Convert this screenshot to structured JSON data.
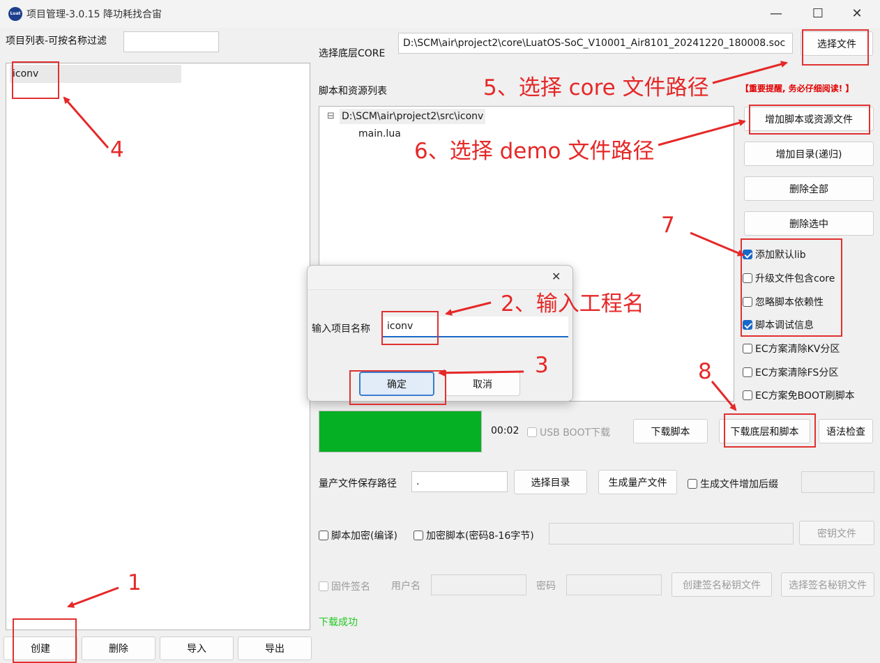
{
  "window": {
    "title": "项目管理-3.0.15 降功耗找合宙",
    "icon_text": "Luat",
    "minimize": "—",
    "maximize": "☐",
    "close": "✕"
  },
  "left": {
    "filter_label": "项目列表-可按名称过滤",
    "filter_value": "",
    "projects": [
      "iconv"
    ],
    "buttons": {
      "create": "创建",
      "delete": "删除",
      "import": "导入",
      "export": "导出"
    }
  },
  "core": {
    "label": "选择底层CORE",
    "path": "D:\\SCM\\air\\project2\\core\\LuatOS-SoC_V10001_Air8101_20241220_180008.soc",
    "select_button": "选择文件"
  },
  "scripts": {
    "label": "脚本和资源列表",
    "warning": "【重要提醒, 务必仔细阅读! 】",
    "tree_toggle": "⊟",
    "tree_root": "D:\\SCM\\air\\project2\\src\\iconv",
    "tree_children": [
      "main.lua"
    ],
    "buttons": {
      "add_file": "增加脚本或资源文件",
      "add_dir": "增加目录(递归)",
      "delete_all": "删除全部",
      "delete_selected": "删除选中"
    }
  },
  "options": [
    {
      "label": "添加默认lib",
      "checked": true
    },
    {
      "label": "升级文件包含core",
      "checked": false
    },
    {
      "label": "忽略脚本依赖性",
      "checked": false
    },
    {
      "label": "脚本调试信息",
      "checked": true
    },
    {
      "label": "EC方案清除KV分区",
      "checked": false
    },
    {
      "label": "EC方案清除FS分区",
      "checked": false
    },
    {
      "label": "EC方案免BOOT刷脚本",
      "checked": false
    }
  ],
  "download": {
    "progress": 1.0,
    "progress_color": "#06b025",
    "time": "00:02",
    "usb_boot": "USB BOOT下载",
    "download_script": "下载脚本",
    "download_all": "下载底层和脚本",
    "syntax_check": "语法检查"
  },
  "production": {
    "label": "量产文件保存路径",
    "path_value": ".",
    "select_dir": "选择目录",
    "generate": "生成量产文件",
    "suffix_check": "生成文件增加后缀"
  },
  "encrypt": {
    "compile_check": "脚本加密(编译)",
    "encrypt_check": "加密脚本(密码8-16字节)",
    "key_file": "密钥文件"
  },
  "sign": {
    "firmware_sign": "固件签名",
    "username": "用户名",
    "password": "密码",
    "create_key": "创建签名秘钥文件",
    "select_key": "选择签名秘钥文件"
  },
  "status": {
    "text": "下载成功",
    "color": "#22c922"
  },
  "dialog": {
    "close": "✕",
    "label": "输入项目名称",
    "value": "iconv",
    "ok": "确定",
    "cancel": "取消"
  },
  "annotations": {
    "n1": "1",
    "n2": "2、输入工程名",
    "n3": "3",
    "n4": "4",
    "n5": "5、选择 core 文件路径",
    "n6": "6、选择 demo 文件路径",
    "n7": "7",
    "n8": "8",
    "color": "#e52828"
  }
}
